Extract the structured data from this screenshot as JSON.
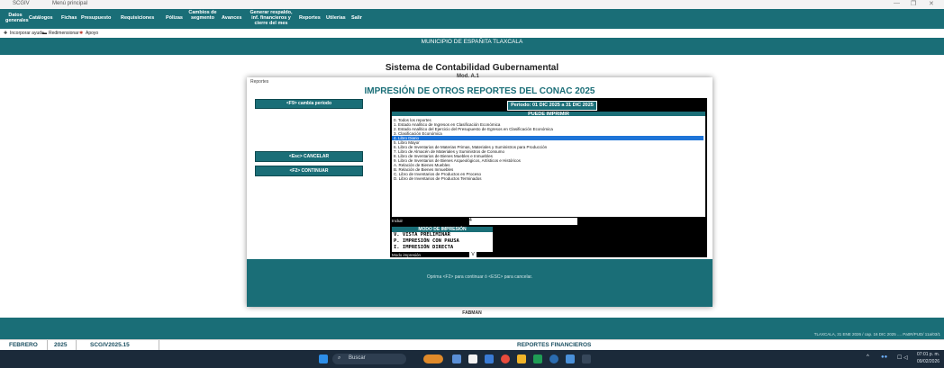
{
  "window": {
    "app": "SCGIV",
    "title": "Menú principal",
    "controls": [
      "—",
      "❐",
      "✕"
    ]
  },
  "menu": [
    {
      "label": "Datos generales"
    },
    {
      "label": "Catálogos"
    },
    {
      "label": "Fichas"
    },
    {
      "label": "Presupuesto"
    },
    {
      "label": "Requisiciones"
    },
    {
      "label": "Pólizas"
    },
    {
      "label": "Cambios de segmento"
    },
    {
      "label": "Avances"
    },
    {
      "label": "Generar respaldo, inf. financieros y cierre del mes"
    },
    {
      "label": "Reportes"
    },
    {
      "label": "Utilerías"
    },
    {
      "label": "Salir"
    }
  ],
  "toolbar": {
    "item1": "Incorporar ayuda",
    "item2": "Redimensionar",
    "item3": "Apoyo"
  },
  "municipio": "MUNICIPIO DE ESPAÑITA TLAXCALA",
  "system_title": "Sistema de Contabilidad Gubernamental",
  "system_sub": "Mod. A.1",
  "dialog": {
    "window_title": "Reportes",
    "heading": "IMPRESIÓN DE OTROS REPORTES DEL CONAC 2025",
    "btn_change_period": "<F9> cambia periodo",
    "btn_cancel": "<Esc> CANCELAR",
    "btn_continue": "<F2> CONTINUAR",
    "periodo": "Periodo: 01 DIC 2025 a 31 DIC 2025",
    "panel_head": "PUEDE IMPRIMIR",
    "reports": [
      "0. Todos los reportes",
      "1. Estado Analítico de Ingresos en Clasificación Económica",
      "2. Estado Analítico del Ejercicio del Presupuesto de Egresos en Clasificación Económica",
      "3. Clasificación Económica",
      "4. Libro Diario",
      "5. Libro Mayor",
      "6. Libro de Inventarios de Materias Primas, Materiales y Suministros para Producción",
      "7. Libro de Almacén de Materiales y Suministros de Consumo",
      "8. Libro de Inventarios de Bienes Muebles e Inmuebles",
      "9. Libro de Inventarios de Bienes Arqueológicos, Artísticos e Históricos",
      "A. Relación de Bienes Muebles",
      "B. Relación de Bienes Inmuebles",
      "C. Libro de Inventarios de Productos en Proceso",
      "D. Libro de Inventarios de Productos Terminados"
    ],
    "selected_index": 4,
    "incluir_label": "Incluir",
    "incluir_value": "4",
    "modo_head": "MODO DE IMPRESIÓN",
    "modo_items": [
      "V. VISTA PRELIMINAR",
      "P. IMPRESIÓN CON PAUSA",
      "I. IMPRESIÓN DIRECTA"
    ],
    "modo_label": "Modo impresión",
    "modo_value": "V",
    "footer_text": "Oprima <F2> para continuar ó <ESC> para cancelar."
  },
  "fab_label": "FABMAN",
  "right_info": "TLAXCALA, 31 ENE 2026 / cap. 16 DIC 2025  ....  Pa0R/PUD/ 11a/03/1",
  "status": {
    "month": "FEBRERO",
    "year": "2025",
    "version": "SCGIV2025.15",
    "module": "REPORTES FINANCIEROS"
  },
  "taskbar": {
    "search": "Buscar",
    "time": "07:01 p. m.",
    "date": "09/02/2026"
  },
  "colors": {
    "teal": "#1a6e77",
    "select_blue": "#1e74d8",
    "taskbar": "#1b2a3a"
  }
}
